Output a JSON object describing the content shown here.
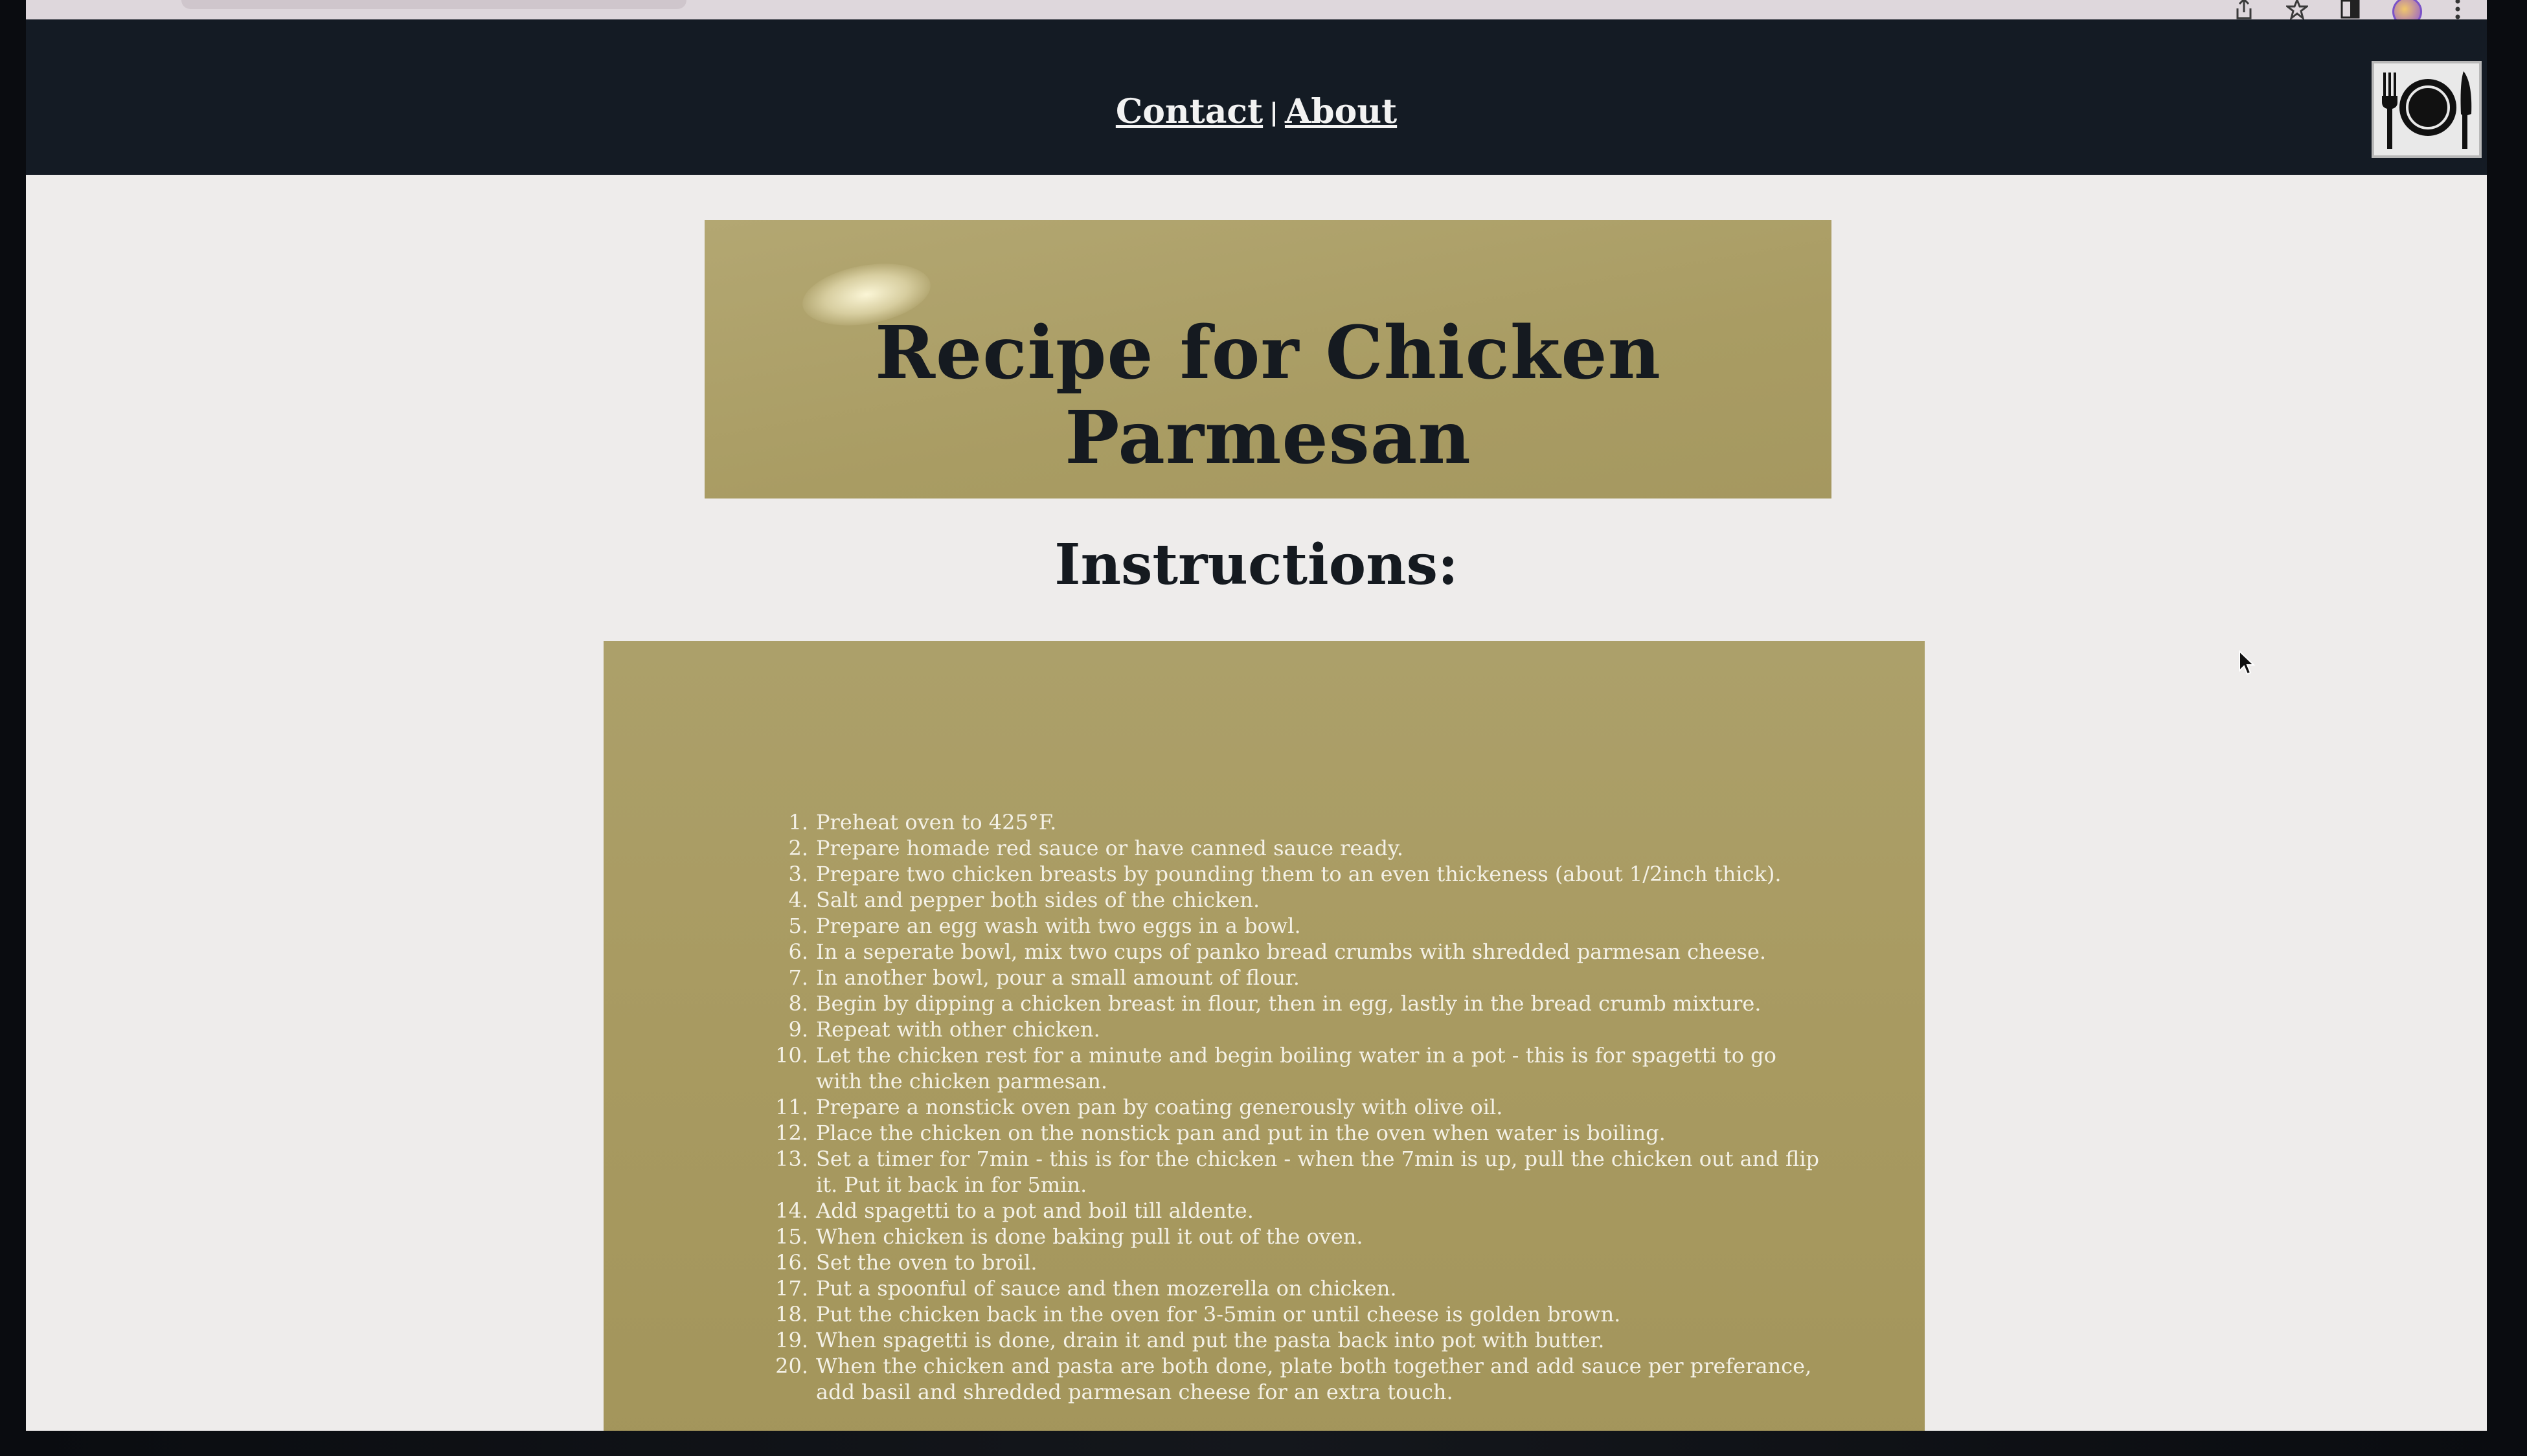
{
  "nav": {
    "contact_label": "Contact",
    "separator": "|",
    "about_label": "About"
  },
  "logo": {
    "icon": "plate-fork-knife-icon"
  },
  "title_card": {
    "title": "Recipe for Chicken Parmesan"
  },
  "instructions": {
    "heading": "Instructions:",
    "steps": [
      "Preheat oven to 425°F.",
      "Prepare homade red sauce or have canned sauce ready.",
      "Prepare two chicken breasts by pounding them to an even thickeness (about 1/2inch thick).",
      "Salt and pepper both sides of the chicken.",
      "Prepare an egg wash with two eggs in a bowl.",
      "In a seperate bowl, mix two cups of panko bread crumbs with shredded parmesan cheese.",
      "In another bowl, pour a small amount of flour.",
      "Begin by dipping a chicken breast in flour, then in egg, lastly in the bread crumb mixture.",
      "Repeat with other chicken.",
      "Let the chicken rest for a minute and begin boiling water in a pot - this is for spagetti to go with the chicken parmesan.",
      "Prepare a nonstick oven pan by coating generously with olive oil.",
      "Place the chicken on the nonstick pan and put in the oven when water is boiling.",
      "Set a timer for 7min - this is for the chicken - when the 7min is up, pull the chicken out and flip it. Put it back in for 5min.",
      "Add spagetti to a pot and boil till aldente.",
      "When chicken is done baking pull it out of the oven.",
      "Set the oven to broil.",
      "Put a spoonful of sauce and then mozerella on chicken.",
      "Put the chicken back in the oven for 3-5min or until cheese is golden brown.",
      "When spagetti is done, drain it and put the pasta back into pot with butter.",
      "When the chicken and pasta are both done, plate both together and add sauce per preferance, add basil and shredded parmesan cheese for an extra touch."
    ]
  },
  "browser_chrome": {
    "icons": [
      "share-icon",
      "bookmark-star-icon",
      "side-panel-icon",
      "profile-avatar",
      "kebab-menu-icon"
    ]
  }
}
